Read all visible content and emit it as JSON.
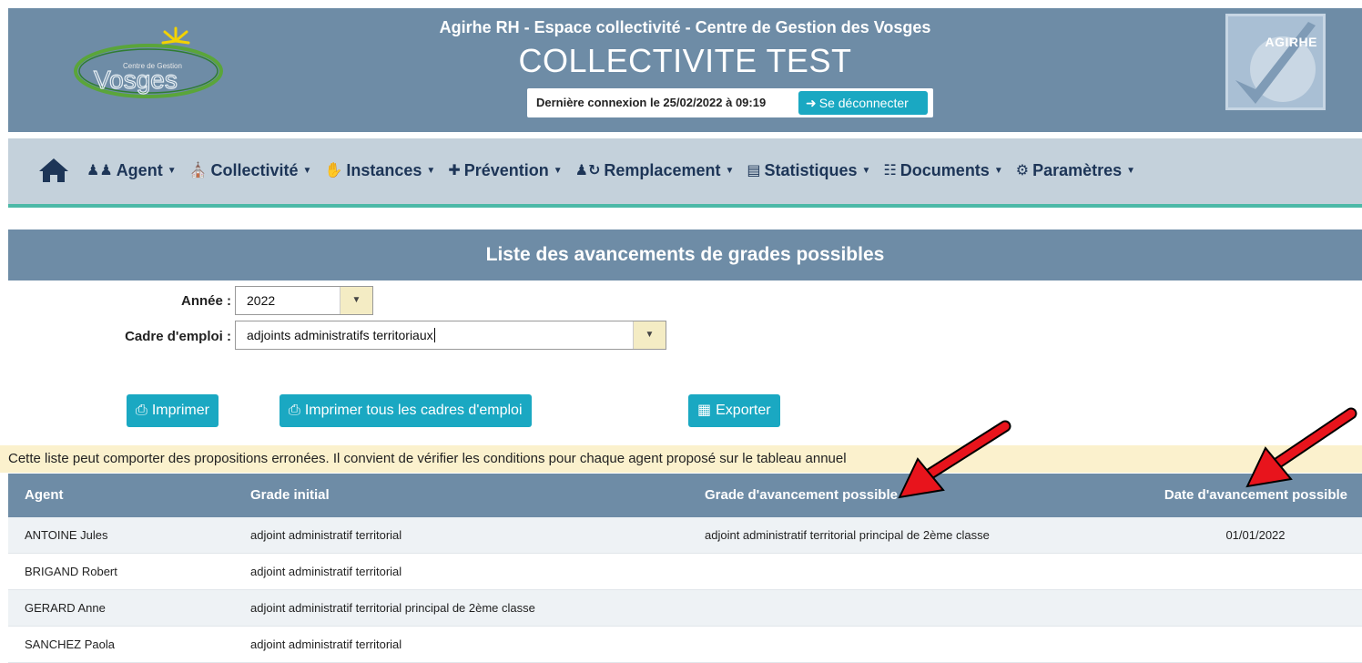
{
  "header": {
    "subtitle": "Agirhe RH - Espace collectivité - Centre de Gestion des Vosges",
    "title": "COLLECTIVITE TEST",
    "last_login": "Dernière connexion le 25/02/2022 à 09:19",
    "logout_label": "Se déconnecter",
    "logo_left_text": "Vosges",
    "logo_left_small": "Centre de Gestion",
    "logo_right_text": "AGIRHE"
  },
  "nav": {
    "items": [
      {
        "label": "Agent",
        "icon": "users-icon"
      },
      {
        "label": "Collectivité",
        "icon": "building-icon"
      },
      {
        "label": "Instances",
        "icon": "handshake-icon"
      },
      {
        "label": "Prévention",
        "icon": "first-aid-icon"
      },
      {
        "label": "Remplacement",
        "icon": "user-swap-icon"
      },
      {
        "label": "Statistiques",
        "icon": "bar-chart-icon"
      },
      {
        "label": "Documents",
        "icon": "document-icon"
      },
      {
        "label": "Paramètres",
        "icon": "gears-icon"
      }
    ]
  },
  "page": {
    "title": "Liste des avancements de grades possibles"
  },
  "form": {
    "year_label": "Année :",
    "year_value": "2022",
    "cadre_label": "Cadre d'emploi :",
    "cadre_value": "adjoints administratifs territoriaux"
  },
  "buttons": {
    "print": "Imprimer",
    "print_all": "Imprimer tous les cadres d'emploi",
    "export": "Exporter"
  },
  "warning": "Cette liste peut comporter des propositions erronées. Il convient de vérifier les conditions pour chaque agent proposé sur le tableau annuel",
  "table": {
    "columns": [
      "Agent",
      "Grade initial",
      "Grade d'avancement possible",
      "Date d'avancement possible"
    ],
    "rows": [
      [
        "ANTOINE Jules",
        "adjoint administratif territorial",
        "adjoint administratif territorial principal de 2ème classe",
        "01/01/2022"
      ],
      [
        "BRIGAND Robert",
        "adjoint administratif territorial",
        "",
        ""
      ],
      [
        "GERARD Anne",
        "adjoint administratif territorial principal de 2ème classe",
        "",
        ""
      ],
      [
        "SANCHEZ Paola",
        "adjoint administratif territorial",
        "",
        ""
      ]
    ]
  },
  "colors": {
    "header_bg": "#6e8ca6",
    "nav_bg": "#c4d1db",
    "accent": "#1aa8c2",
    "nav_border": "#4cb9a7",
    "warning_bg": "#fbf1cd",
    "annotation_arrow": "#e8141c"
  }
}
